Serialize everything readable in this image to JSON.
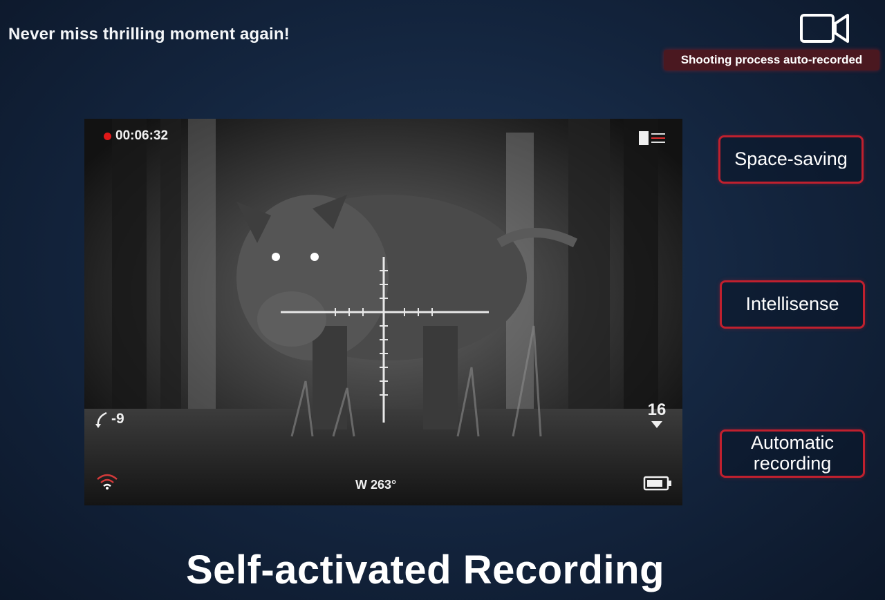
{
  "banner": {
    "text": "Never miss thrilling moment again!"
  },
  "badge": {
    "icon": "video-camera-icon",
    "text": "Shooting process auto-recorded"
  },
  "scope": {
    "recording_time": "00:06:32",
    "angle": "-9",
    "heading": "W 263°",
    "zoom": "16",
    "icons": [
      "sd-card-icon",
      "wifi-icon",
      "battery-icon",
      "crosshair-reticle"
    ]
  },
  "features": [
    {
      "label": "Space-saving"
    },
    {
      "label": "Intellisense"
    },
    {
      "label": "Automatic recording"
    }
  ],
  "title": "Self-activated Recording",
  "colors": {
    "accent_red": "#c0202e",
    "background": "#13243d",
    "recording_dot": "#e01818"
  }
}
